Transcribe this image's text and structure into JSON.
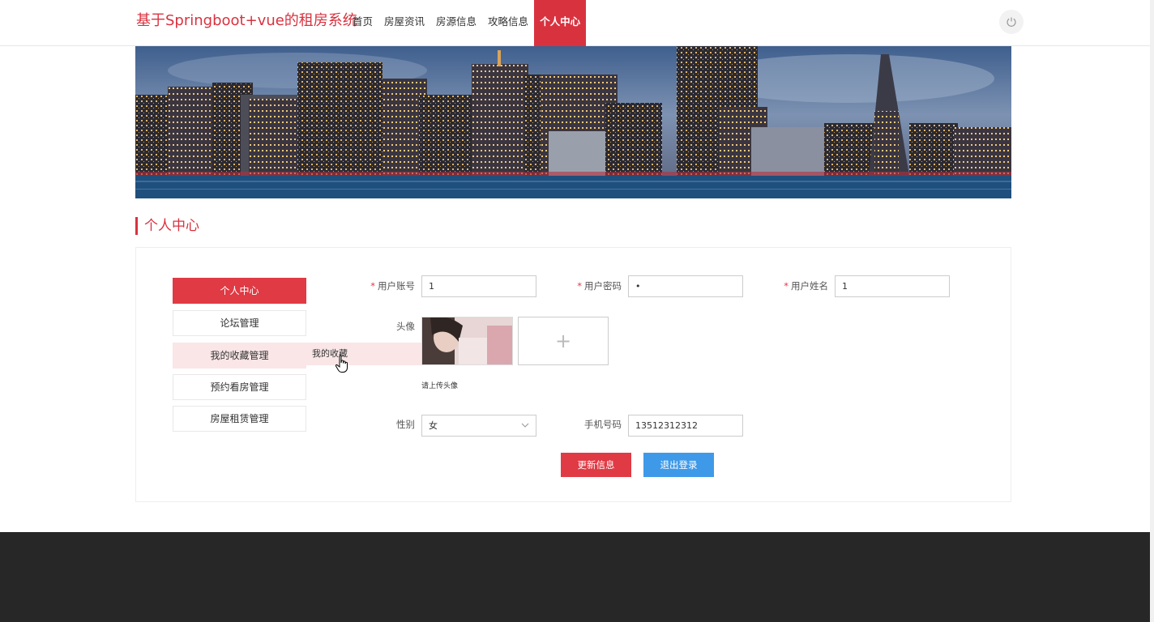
{
  "header": {
    "site_title": "基于Springboot+vue的租房系统",
    "nav": [
      {
        "label": "首页"
      },
      {
        "label": "房屋资讯"
      },
      {
        "label": "房源信息"
      },
      {
        "label": "攻略信息"
      },
      {
        "label": "个人中心",
        "active": true
      }
    ],
    "power_icon": "power-icon"
  },
  "section_title": "个人中心",
  "sidebar": {
    "items": [
      {
        "label": "个人中心",
        "state": "active"
      },
      {
        "label": "论坛管理"
      },
      {
        "label": "我的收藏管理",
        "state": "hover"
      },
      {
        "label": "预约看房管理"
      },
      {
        "label": "房屋租赁管理"
      }
    ],
    "submenu": {
      "label": "我的收藏"
    }
  },
  "form": {
    "account": {
      "label": "用户账号",
      "value": "1"
    },
    "password": {
      "label": "用户密码",
      "value": "•"
    },
    "name": {
      "label": "用户姓名",
      "value": "1"
    },
    "avatar": {
      "label": "头像",
      "upload_symbol": "+",
      "hint": "请上传头像"
    },
    "gender": {
      "label": "性别",
      "value": "女"
    },
    "phone": {
      "label": "手机号码",
      "value": "13512312312"
    }
  },
  "buttons": {
    "update": "更新信息",
    "logout": "退出登录"
  },
  "colors": {
    "accent": "#d9323f",
    "primary_blue": "#3e9ae8",
    "footer": "#272727"
  }
}
